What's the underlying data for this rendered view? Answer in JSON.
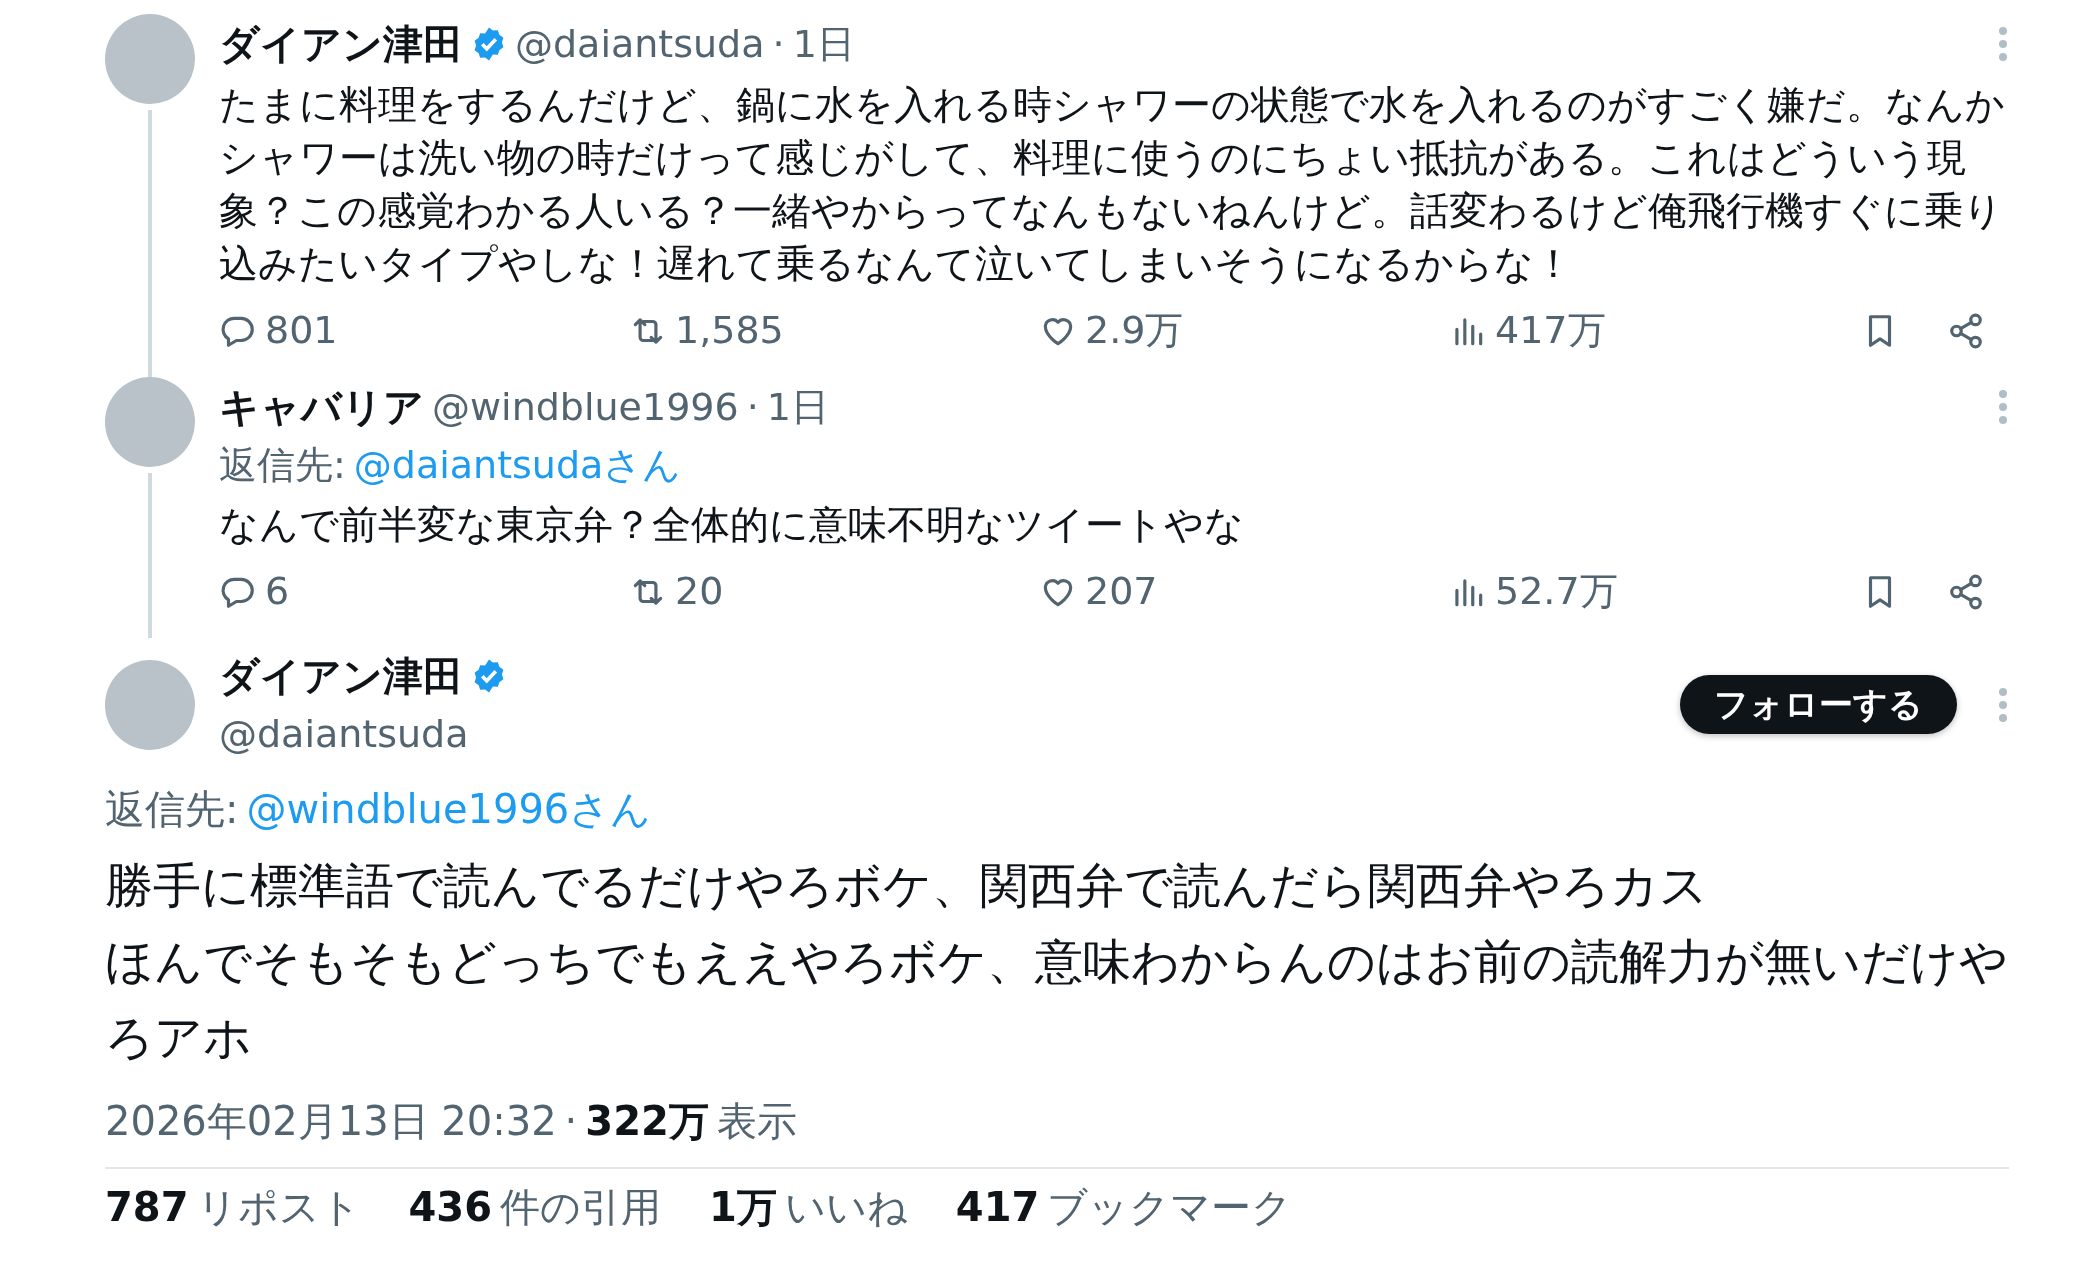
{
  "thread": [
    {
      "name": "ダイアン津田",
      "verified": true,
      "handle": "@daiantsuda",
      "separator": "·",
      "time": "1日",
      "text": "たまに料理をするんだけど、鍋に水を入れる時シャワーの状態で水を入れるのがすごく嫌だ。なんかシャワーは洗い物の時だけって感じがして、料理に使うのにちょい抵抗がある。これはどういう現象？この感覚わかる人いる？一緒やからってなんもないねんけど。話変わるけど俺飛行機すぐに乗り込みたいタイプやしな！遅れて乗るなんて泣いてしまいそうになるからな！",
      "replies": "801",
      "reposts": "1,585",
      "likes": "2.9万",
      "views": "417万"
    },
    {
      "name": "キャバリア",
      "verified": false,
      "handle": "@windblue1996",
      "separator": "·",
      "time": "1日",
      "reply_to": {
        "label": "返信先:",
        "user": "@daiantsudaさん"
      },
      "text": "なんで前半変な東京弁？全体的に意味不明なツイートやな",
      "replies": "6",
      "reposts": "20",
      "likes": "207",
      "views": "52.7万"
    }
  ],
  "focal": {
    "name": "ダイアン津田",
    "verified": true,
    "handle": "@daiantsuda",
    "follow_label": "フォローする",
    "reply_to": {
      "label": "返信先:",
      "user": "@windblue1996さん"
    },
    "lines": [
      "勝手に標準語で読んでるだけやろボケ、関西弁で読んだら関西弁やろカス",
      "ほんでそもそもどっちでもええやろボケ、意味わからんのはお前の読解力が無いだけやろアホ"
    ],
    "timestamp": "2026年02月13日 20:32",
    "separator": "·",
    "view_count": "322万",
    "view_label": "表示",
    "stats": [
      {
        "count": "787",
        "label": "リポスト"
      },
      {
        "count": "436",
        "label": "件の引用"
      },
      {
        "count": "1万",
        "label": "いいね"
      },
      {
        "count": "417",
        "label": "ブックマーク"
      }
    ]
  }
}
